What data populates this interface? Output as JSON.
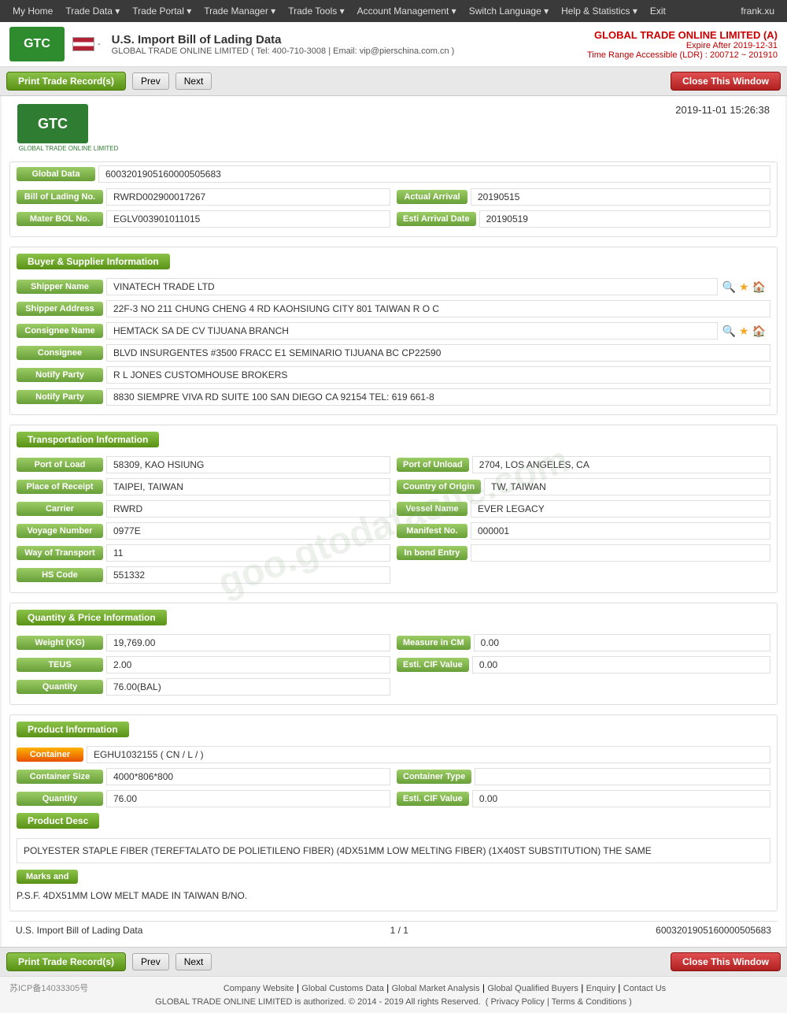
{
  "nav": {
    "items": [
      "My Home",
      "Trade Data",
      "Trade Portal",
      "Trade Manager",
      "Trade Tools",
      "Account Management",
      "Switch Language",
      "Help & Statistics",
      "Exit"
    ],
    "user": "frank.xu"
  },
  "header": {
    "logo_text": "GTC",
    "logo_sub": "GLOBAL TRADE ONLINE LIMITED",
    "title": "U.S. Import Bill of Lading Data",
    "contact": "GLOBAL TRADE ONLINE LIMITED ( Tel: 400-710-3008 | Email: vip@pierschina.com.cn )",
    "company": "GLOBAL TRADE ONLINE LIMITED (A)",
    "expire": "Expire After 2019-12-31",
    "time_range": "Time Range Accessible (LDR) : 200712 ~ 201910"
  },
  "toolbar": {
    "print_label": "Print Trade Record(s)",
    "prev_label": "Prev",
    "next_label": "Next",
    "close_label": "Close This Window"
  },
  "document": {
    "logo_text": "GTC",
    "logo_sub": "GLOBAL TRADE ONLINE LIMITED",
    "timestamp": "2019-11-01 15:26:38",
    "global_data_label": "Global Data",
    "global_data_value": "6003201905160000505683",
    "bol_label": "Bill of Lading No.",
    "bol_value": "RWRD002900017267",
    "actual_arrival_label": "Actual Arrival",
    "actual_arrival_value": "20190515",
    "master_bol_label": "Mater BOL No.",
    "master_bol_value": "EGLV003901011015",
    "esti_arrival_label": "Esti Arrival Date",
    "esti_arrival_value": "20190519"
  },
  "buyer_supplier": {
    "section_title": "Buyer & Supplier Information",
    "shipper_name_label": "Shipper Name",
    "shipper_name_value": "VINATECH TRADE LTD",
    "shipper_address_label": "Shipper Address",
    "shipper_address_value": "22F-3 NO 211 CHUNG CHENG 4 RD KAOHSIUNG CITY 801 TAIWAN R O C",
    "consignee_name_label": "Consignee Name",
    "consignee_name_value": "HEMTACK SA DE CV TIJUANA BRANCH",
    "consignee_label": "Consignee",
    "consignee_value": "BLVD INSURGENTES #3500 FRACC E1 SEMINARIO TIJUANA BC CP22590",
    "notify_party_label": "Notify Party",
    "notify_party_value1": "R L JONES CUSTOMHOUSE BROKERS",
    "notify_party_value2": "8830 SIEMPRE VIVA RD SUITE 100 SAN DIEGO CA 92154 TEL: 619 661-8"
  },
  "transportation": {
    "section_title": "Transportation Information",
    "port_of_load_label": "Port of Load",
    "port_of_load_value": "58309, KAO HSIUNG",
    "port_of_unload_label": "Port of Unload",
    "port_of_unload_value": "2704, LOS ANGELES, CA",
    "place_of_receipt_label": "Place of Receipt",
    "place_of_receipt_value": "TAIPEI, TAIWAN",
    "country_of_origin_label": "Country of Origin",
    "country_of_origin_value": "TW, TAIWAN",
    "carrier_label": "Carrier",
    "carrier_value": "RWRD",
    "vessel_name_label": "Vessel Name",
    "vessel_name_value": "EVER LEGACY",
    "voyage_number_label": "Voyage Number",
    "voyage_number_value": "0977E",
    "manifest_no_label": "Manifest No.",
    "manifest_no_value": "000001",
    "way_of_transport_label": "Way of Transport",
    "way_of_transport_value": "11",
    "in_bond_entry_label": "In bond Entry",
    "in_bond_entry_value": "",
    "hs_code_label": "HS Code",
    "hs_code_value": "551332"
  },
  "quantity_price": {
    "section_title": "Quantity & Price Information",
    "weight_label": "Weight (KG)",
    "weight_value": "19,769.00",
    "measure_label": "Measure in CM",
    "measure_value": "0.00",
    "teus_label": "TEUS",
    "teus_value": "2.00",
    "esti_cif_label": "Esti. CIF Value",
    "esti_cif_value": "0.00",
    "quantity_label": "Quantity",
    "quantity_value": "76.00(BAL)"
  },
  "product_info": {
    "section_title": "Product Information",
    "container_label": "Container",
    "container_value": "EGHU1032155 ( CN / L / )",
    "container_size_label": "Container Size",
    "container_size_value": "4000*806*800",
    "container_type_label": "Container Type",
    "container_type_value": "",
    "quantity_label": "Quantity",
    "quantity_value": "76.00",
    "esti_cif_label": "Esti. CIF Value",
    "esti_cif_value": "0.00",
    "product_desc_label": "Product Desc",
    "product_desc_value": "POLYESTER STAPLE FIBER (TEREFTALATO DE POLIETILENO FIBER) (4DX51MM LOW MELTING FIBER) (1X40ST SUBSTITUTION) THE SAME",
    "marks_label": "Marks and",
    "marks_value": "P.S.F. 4DX51MM LOW MELT MADE IN TAIWAN B/NO."
  },
  "doc_footer": {
    "left": "U.S. Import Bill of Lading Data",
    "page": "1 / 1",
    "id": "6003201905160000505683"
  },
  "footer": {
    "icp": "苏ICP备14033305号",
    "links": [
      "Company Website",
      "Global Customs Data",
      "Global Market Analysis",
      "Global Qualified Buyers",
      "Enquiry",
      "Contact Us"
    ],
    "copyright": "GLOBAL TRADE ONLINE LIMITED is authorized. © 2014 - 2019 All rights Reserved.",
    "policy_links": [
      "Privacy Policy",
      "Terms & Conditions"
    ]
  },
  "watermark": "goo.gtodatasite.com"
}
